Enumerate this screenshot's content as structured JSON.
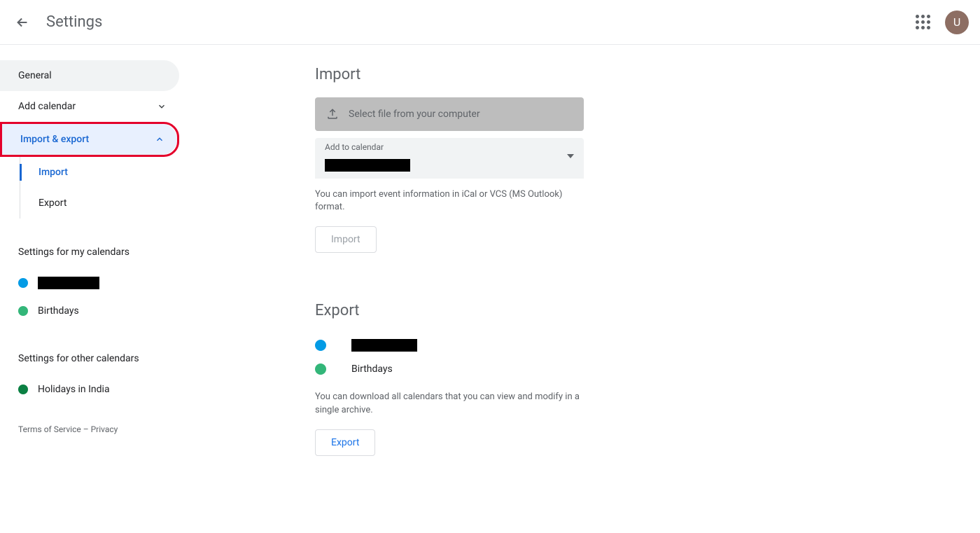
{
  "header": {
    "title": "Settings",
    "avatar_initial": "U"
  },
  "sidebar": {
    "general": "General",
    "add_calendar": "Add calendar",
    "import_export": "Import & export",
    "sub": {
      "import": "Import",
      "export": "Export"
    },
    "section_my": "Settings for my calendars",
    "my_calendars": [
      {
        "label": "",
        "redacted": true,
        "color": "#039be5",
        "width": 88
      },
      {
        "label": "Birthdays",
        "redacted": false,
        "color": "#33b679"
      }
    ],
    "section_other": "Settings for other calendars",
    "other_calendars": [
      {
        "label": "Holidays in India",
        "color": "#0b8043"
      }
    ]
  },
  "footer": {
    "terms": "Terms of Service",
    "privacy": "Privacy"
  },
  "main": {
    "import": {
      "title": "Import",
      "select_file": "Select file from your computer",
      "add_to_label": "Add to calendar",
      "helper": "You can import event information in iCal or VCS (MS Outlook) format.",
      "button": "Import"
    },
    "export": {
      "title": "Export",
      "rows": [
        {
          "label": "",
          "redacted": true,
          "color": "#039be5"
        },
        {
          "label": "Birthdays",
          "redacted": false,
          "color": "#33b679"
        }
      ],
      "helper": "You can download all calendars that you can view and modify in a single archive.",
      "button": "Export"
    }
  }
}
